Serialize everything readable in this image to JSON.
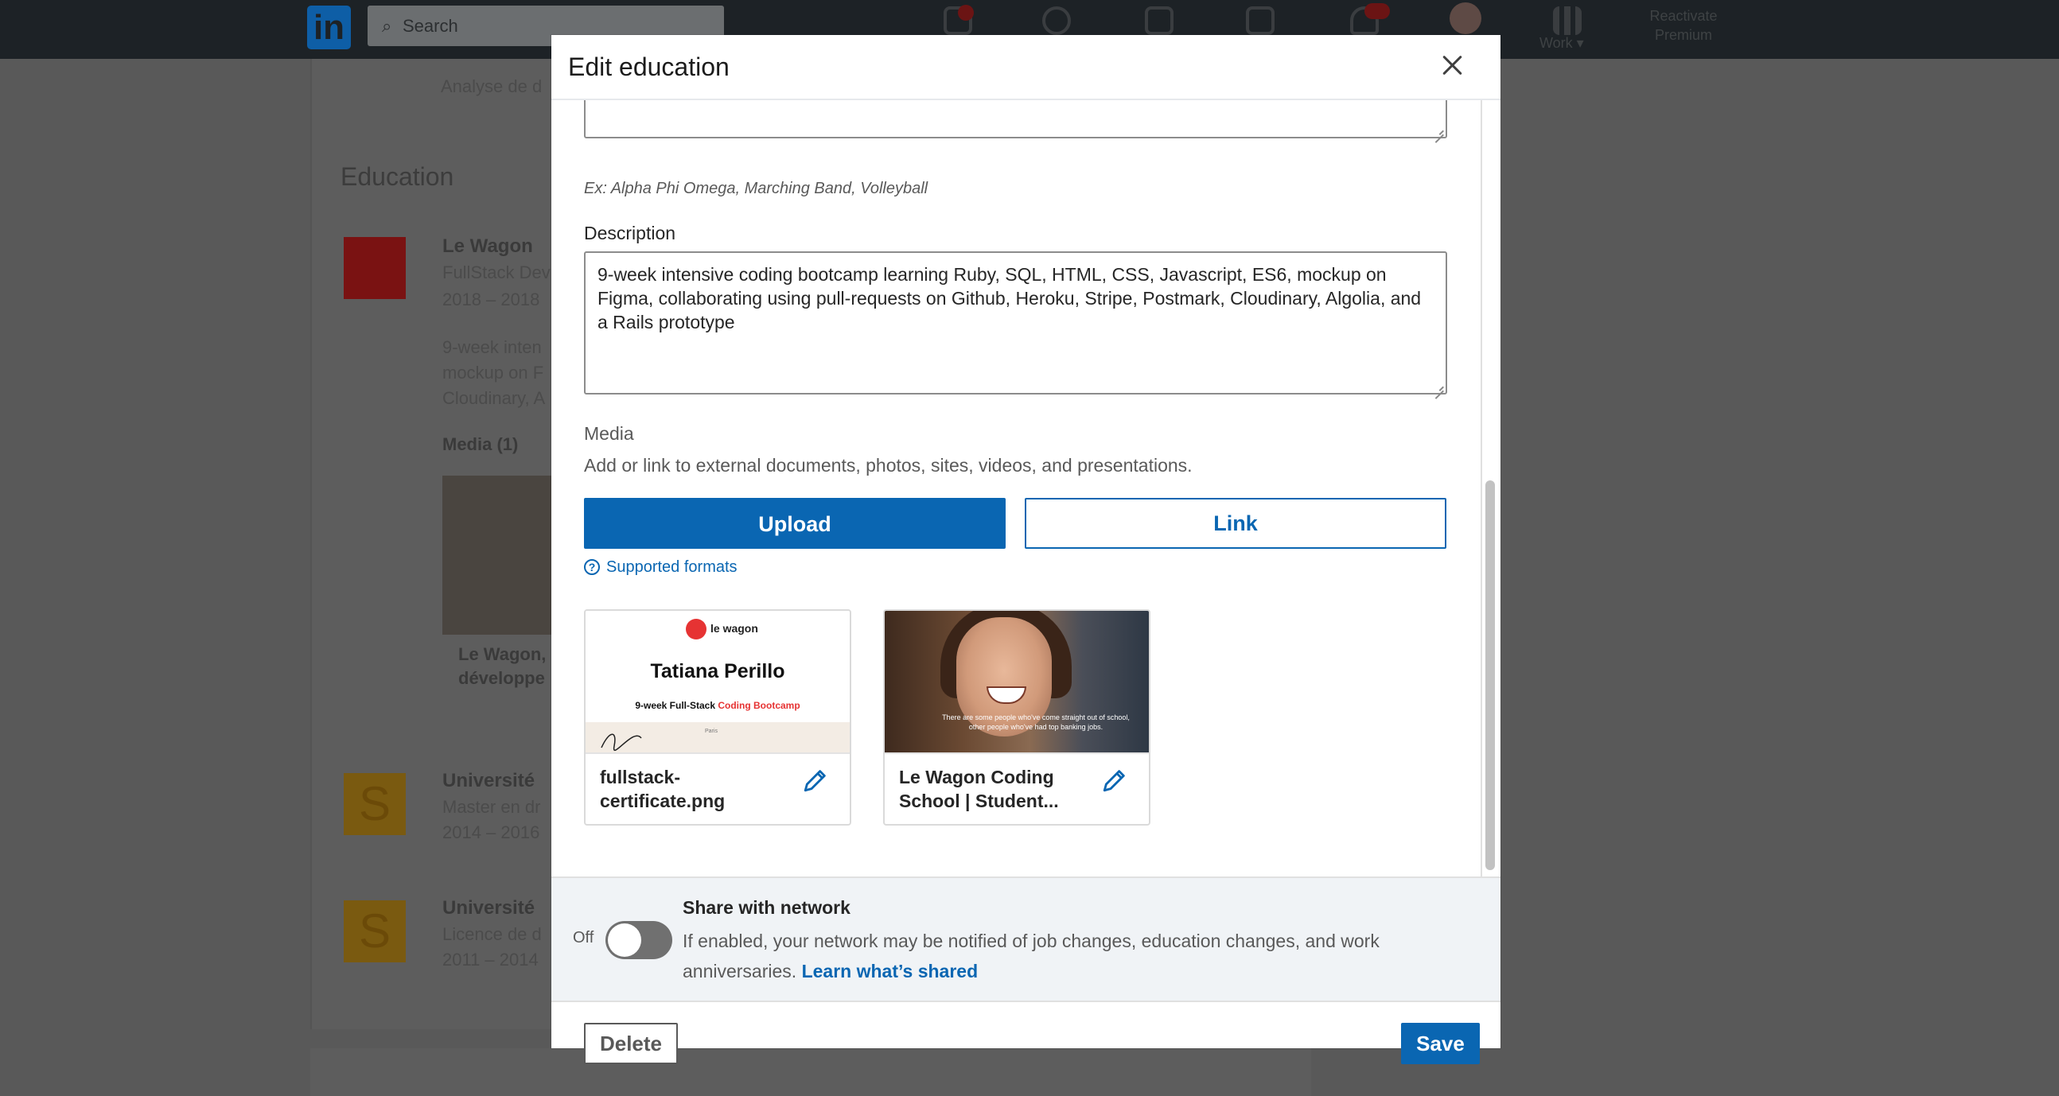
{
  "background": {
    "search_placeholder": "Search",
    "nav_work": "Work ▾",
    "nav_premium": "Reactivate Premium",
    "partial_line": "Analyse de d",
    "education_heading": "Education",
    "entries": [
      {
        "school": "Le Wagon",
        "degree": "FullStack Dev",
        "dates": "2018 – 2018"
      },
      {
        "school": "Université",
        "degree": "Master en dr",
        "dates": "2014 – 2016"
      },
      {
        "school": "Université",
        "degree": "Licence de d",
        "dates": "2011 – 2014"
      }
    ],
    "desc_lines": [
      "9-week inten",
      "mockup on F",
      "Cloudinary, A"
    ],
    "media_label": "Media (1)",
    "media_card_lines": [
      "Le Wagon,",
      "développe"
    ]
  },
  "modal": {
    "title": "Edit education",
    "activities_hint": "Ex: Alpha Phi Omega, Marching Band, Volleyball",
    "description_label": "Description",
    "description_value": "9-week intensive coding bootcamp learning Ruby, SQL, HTML, CSS, Javascript, ES6, mockup on Figma, collaborating using pull-requests on Github, Heroku, Stripe, Postmark, Cloudinary, Algolia, and a Rails prototype",
    "media_label": "Media",
    "media_desc": "Add or link to external documents, photos, sites, videos, and presentations.",
    "upload_label": "Upload",
    "link_label": "Link",
    "supported_formats": "Supported formats",
    "media_items": [
      {
        "title": "fullstack-certificate.png"
      },
      {
        "title": "Le Wagon Coding School | Student..."
      }
    ],
    "certificate": {
      "brand": "le wagon",
      "name": "Tatiana Perillo",
      "course_prefix": "9-week Full-Stack ",
      "course_highlight": "Coding Bootcamp",
      "city": "Paris"
    },
    "photo_caption": "There are some people who've come straight out of school, other people who've had top banking jobs.",
    "share": {
      "off_label": "Off",
      "title": "Share with network",
      "description": "If enabled, your network may be notified of job changes, education changes, and work anniversaries.",
      "learn_link": "Learn what’s shared",
      "enabled": false
    },
    "delete_label": "Delete",
    "save_label": "Save"
  },
  "colors": {
    "primary": "#0a66b2",
    "overlay_bg": "#595959",
    "topbar": "#1d2226"
  }
}
